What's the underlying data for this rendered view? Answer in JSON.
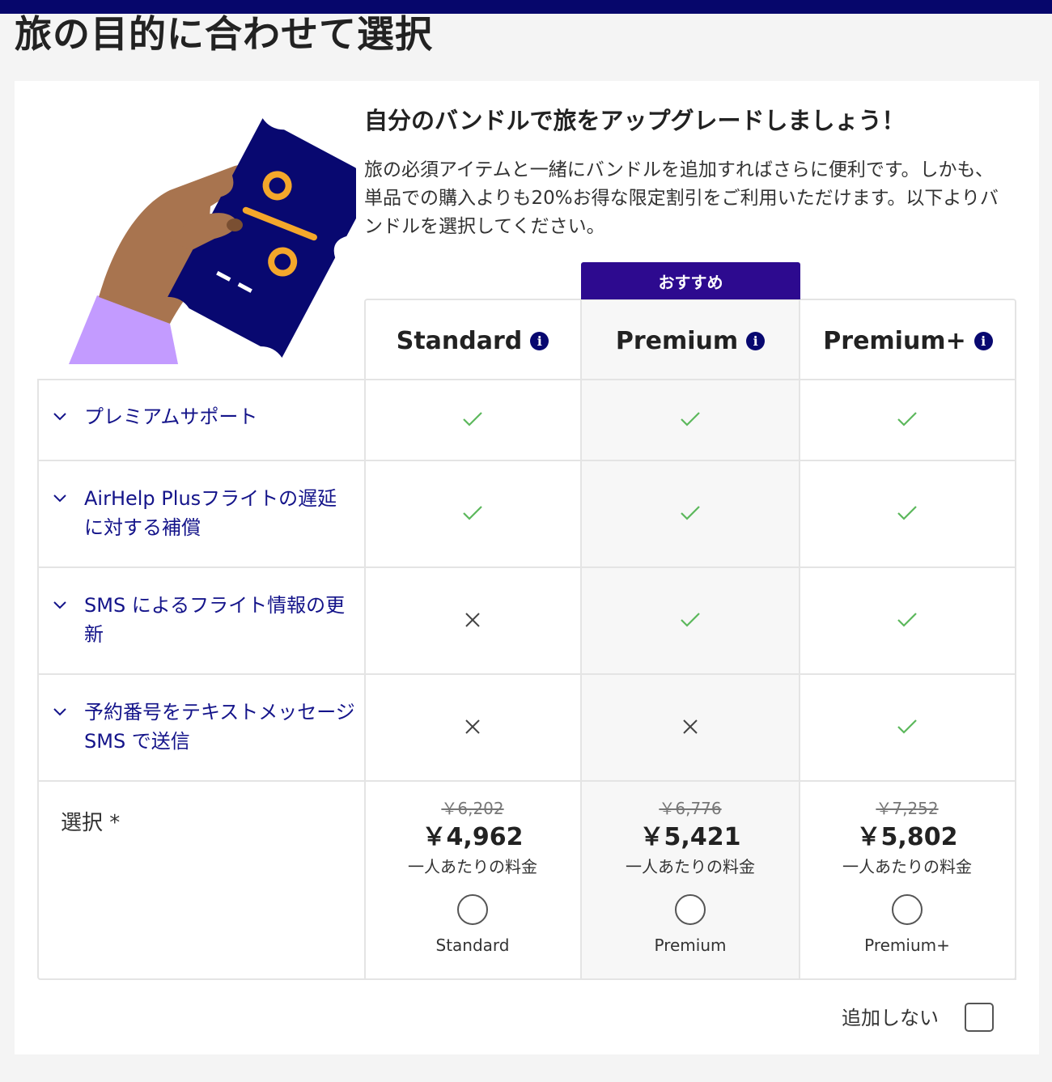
{
  "page": {
    "title": "旅の目的に合わせて選択"
  },
  "promo": {
    "title": "自分のバンドルで旅をアップグレードしましょう！",
    "description": "旅の必須アイテムと一緒にバンドルを追加すればさらに便利です。しかも、単品での購入よりも20%お得な限定割引をご利用いただけます。以下よりバンドルを選択してください。"
  },
  "recommended_badge": "おすすめ",
  "plans": [
    {
      "name": "Standard",
      "old_price": "￥6,202",
      "price": "￥4,962",
      "per_person": "一人あたりの料金",
      "radio_label": "Standard",
      "selected": false
    },
    {
      "name": "Premium",
      "old_price": "￥6,776",
      "price": "￥5,421",
      "per_person": "一人あたりの料金",
      "radio_label": "Premium",
      "selected": false
    },
    {
      "name": "Premium+",
      "old_price": "￥7,252",
      "price": "￥5,802",
      "per_person": "一人あたりの料金",
      "radio_label": "Premium+",
      "selected": false
    }
  ],
  "features": [
    {
      "label": "プレミアムサポート",
      "included": [
        true,
        true,
        true
      ]
    },
    {
      "label": "AirHelp Plusフライトの遅延に対する補償",
      "included": [
        true,
        true,
        true
      ]
    },
    {
      "label": "SMS によるフライト情報の更新",
      "included": [
        false,
        true,
        true
      ]
    },
    {
      "label": "予約番号をテキストメッセージ SMS で送信",
      "included": [
        false,
        false,
        true
      ]
    }
  ],
  "select_label": "選択 *",
  "no_add": {
    "label": "追加しない",
    "checked": false
  },
  "icons": {
    "info": "info-icon",
    "included": "check-icon",
    "excluded": "cross-icon",
    "expand": "chevron-down-icon"
  },
  "colors": {
    "top_bar": "#06066b",
    "recommended_badge": "#2d0a8f",
    "feature_text": "#14148a",
    "check": "#5cb85c",
    "ticket": "#080870",
    "percent": "#f4a72b",
    "sleeve": "#c39bff",
    "hand": "#a8744f"
  }
}
